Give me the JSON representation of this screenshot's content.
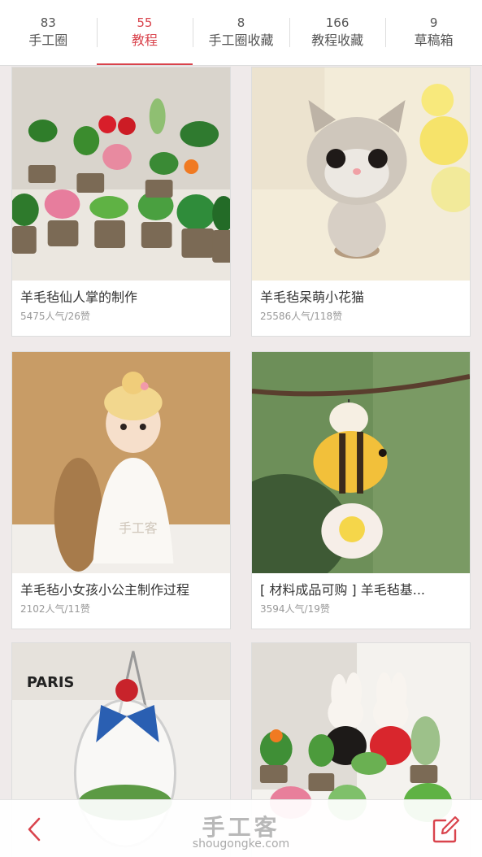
{
  "tabs": [
    {
      "count": "83",
      "label": "手工圈",
      "active": false
    },
    {
      "count": "55",
      "label": "教程",
      "active": true
    },
    {
      "count": "8",
      "label": "手工圈收藏",
      "active": false
    },
    {
      "count": "166",
      "label": "教程收藏",
      "active": false
    },
    {
      "count": "9",
      "label": "草稿箱",
      "active": false
    }
  ],
  "cards": [
    {
      "title": "羊毛毡仙人掌的制作",
      "stats": "5475人气/26赞"
    },
    {
      "title": "羊毛毡呆萌小花猫",
      "stats": "25586人气/118赞"
    },
    {
      "title": "羊毛毡小女孩小公主制作过程",
      "stats": "2102人气/11赞"
    },
    {
      "title": "[ 材料成品可购 ] 羊毛毡基...",
      "stats": "3594人气/19赞"
    },
    {
      "title": "",
      "stats": ""
    },
    {
      "title": "",
      "stats": ""
    }
  ],
  "images": {
    "paris_text": "PARIS",
    "doll_watermark": "手工客"
  },
  "watermark": {
    "logo": "手工客",
    "domain": "shougongke.com"
  },
  "colors": {
    "accent": "#d9434c",
    "background": "#efeaea"
  },
  "icons": {
    "back": "chevron-left",
    "edit": "pencil-square"
  }
}
